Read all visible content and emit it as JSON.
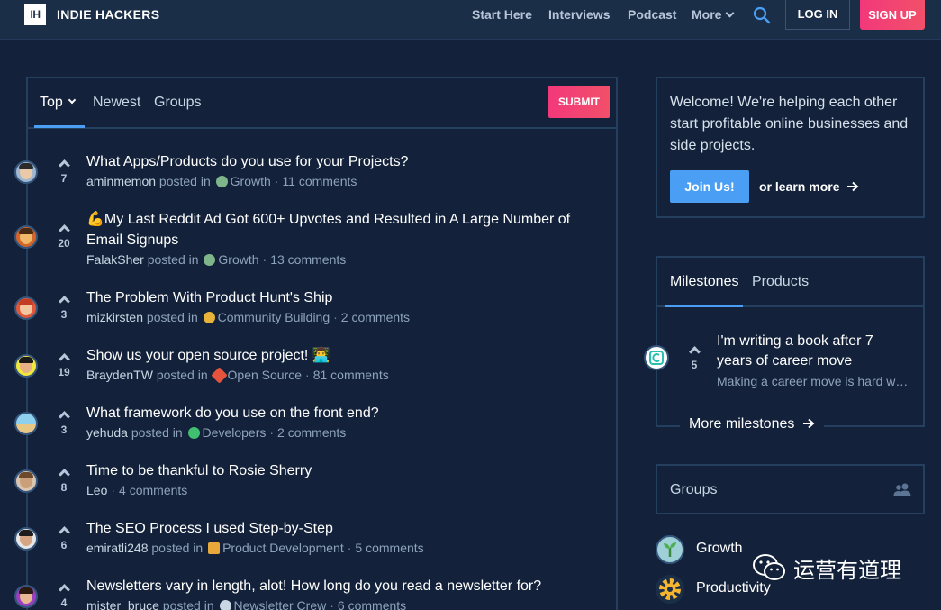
{
  "header": {
    "logo_mark": "IH",
    "logo_text": "INDIE HACKERS",
    "nav": [
      "Start Here",
      "Interviews",
      "Podcast",
      "More"
    ],
    "login_label": "LOG IN",
    "signup_label": "SIGN UP"
  },
  "feed": {
    "tabs": [
      "Top",
      "Newest",
      "Groups"
    ],
    "submit_label": "SUBMIT",
    "posted_in": "posted in",
    "posts": [
      {
        "votes": "7",
        "title": "What Apps/Products do you use for your Projects?",
        "user": "aminmemon",
        "group": "Growth",
        "comments": "11 comments"
      },
      {
        "votes": "20",
        "title": "💪My Last Reddit Ad Got 600+ Upvotes and Resulted in A Large Number of Email Signups",
        "user": "FalakSher",
        "group": "Growth",
        "comments": "13 comments"
      },
      {
        "votes": "3",
        "title": "The Problem With Product Hunt's Ship",
        "user": "mizkirsten",
        "group": "Community Building",
        "comments": "2 comments"
      },
      {
        "votes": "19",
        "title": "Show us your open source project! 👨‍💻",
        "user": "BraydenTW",
        "group": "Open Source",
        "comments": "81 comments"
      },
      {
        "votes": "3",
        "title": "What framework do you use on the front end?",
        "user": "yehuda",
        "group": "Developers",
        "comments": "2 comments"
      },
      {
        "votes": "8",
        "title": "Time to be thankful to Rosie Sherry",
        "user": "Leo",
        "group": "",
        "comments": "4 comments"
      },
      {
        "votes": "6",
        "title": "The SEO Process I used Step-by-Step",
        "user": "emiratli248",
        "group": "Product Development",
        "comments": "5 comments"
      },
      {
        "votes": "4",
        "title": "Newsletters vary in length, alot! How long do you read a newsletter for?",
        "user": "mister_bruce",
        "group": "Newsletter Crew",
        "comments": "6 comments"
      }
    ]
  },
  "welcome": {
    "text": "Welcome! We're helping each other start profitable online businesses and side projects.",
    "join_label": "Join Us!",
    "learn_label": "or learn more"
  },
  "milestones": {
    "tabs": [
      "Milestones",
      "Products"
    ],
    "item": {
      "votes": "5",
      "title": "I'm writing a book after 7 years of career move",
      "subtitle": "Making a career move is hard when you've been"
    },
    "more_label": "More milestones"
  },
  "groups": {
    "title": "Groups",
    "items": [
      "Growth",
      "Productivity"
    ]
  },
  "watermark": {
    "text": "运营有道理"
  },
  "colors": {
    "accent": "#4a9ff5",
    "brand_pink": "#f2387a",
    "bg": "#13223a",
    "header_bg": "#1b2e48"
  }
}
